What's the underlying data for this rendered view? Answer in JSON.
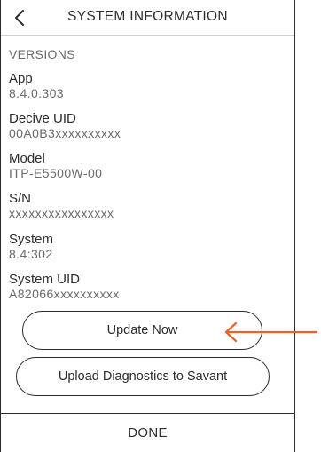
{
  "header": {
    "title": "SYSTEM INFORMATION",
    "back_icon": "chevron-left-icon"
  },
  "versions": {
    "section_title": "VERSIONS",
    "items": [
      {
        "label": "App",
        "value": "8.4.0.303"
      },
      {
        "label": "Decive UID",
        "value": "00A0B3xxxxxxxxxx"
      },
      {
        "label": "Model",
        "value": "ITP-E5500W-00"
      },
      {
        "label": "S/N",
        "value": "xxxxxxxxxxxxxxxx"
      },
      {
        "label": "System",
        "value": "8.4:302"
      },
      {
        "label": "System UID",
        "value": "A82066xxxxxxxxxx"
      }
    ]
  },
  "actions": {
    "update_label": "Update Now",
    "upload_label": "Upload Diagnostics to Savant"
  },
  "footer": {
    "done_label": "DONE"
  },
  "annotation": {
    "arrow_color": "#e8642c"
  }
}
